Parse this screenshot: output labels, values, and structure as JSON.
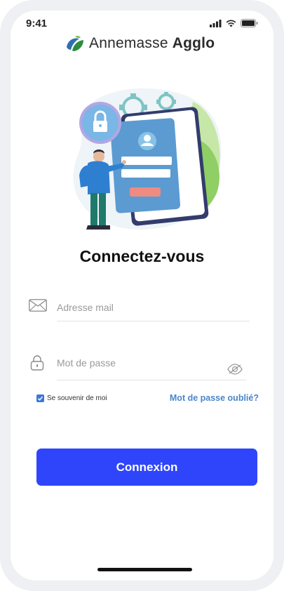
{
  "status_bar": {
    "time": "9:41"
  },
  "brand": {
    "name_light": "Annemasse",
    "name_bold": "Agglo"
  },
  "login": {
    "title": "Connectez-vous",
    "email_placeholder": "Adresse mail",
    "password_placeholder": "Mot de passe",
    "remember_label": "Se souvenir de moi",
    "remember_checked": true,
    "forgot_link": "Mot de passe oublié?",
    "submit_label": "Connexion"
  },
  "colors": {
    "primary_button": "#2f45fb",
    "link": "#4a86c8",
    "checkbox": "#3c78d8"
  },
  "icons": {
    "email": "envelope-icon",
    "password": "lock-icon",
    "toggle_visibility": "eye-slash-icon"
  }
}
